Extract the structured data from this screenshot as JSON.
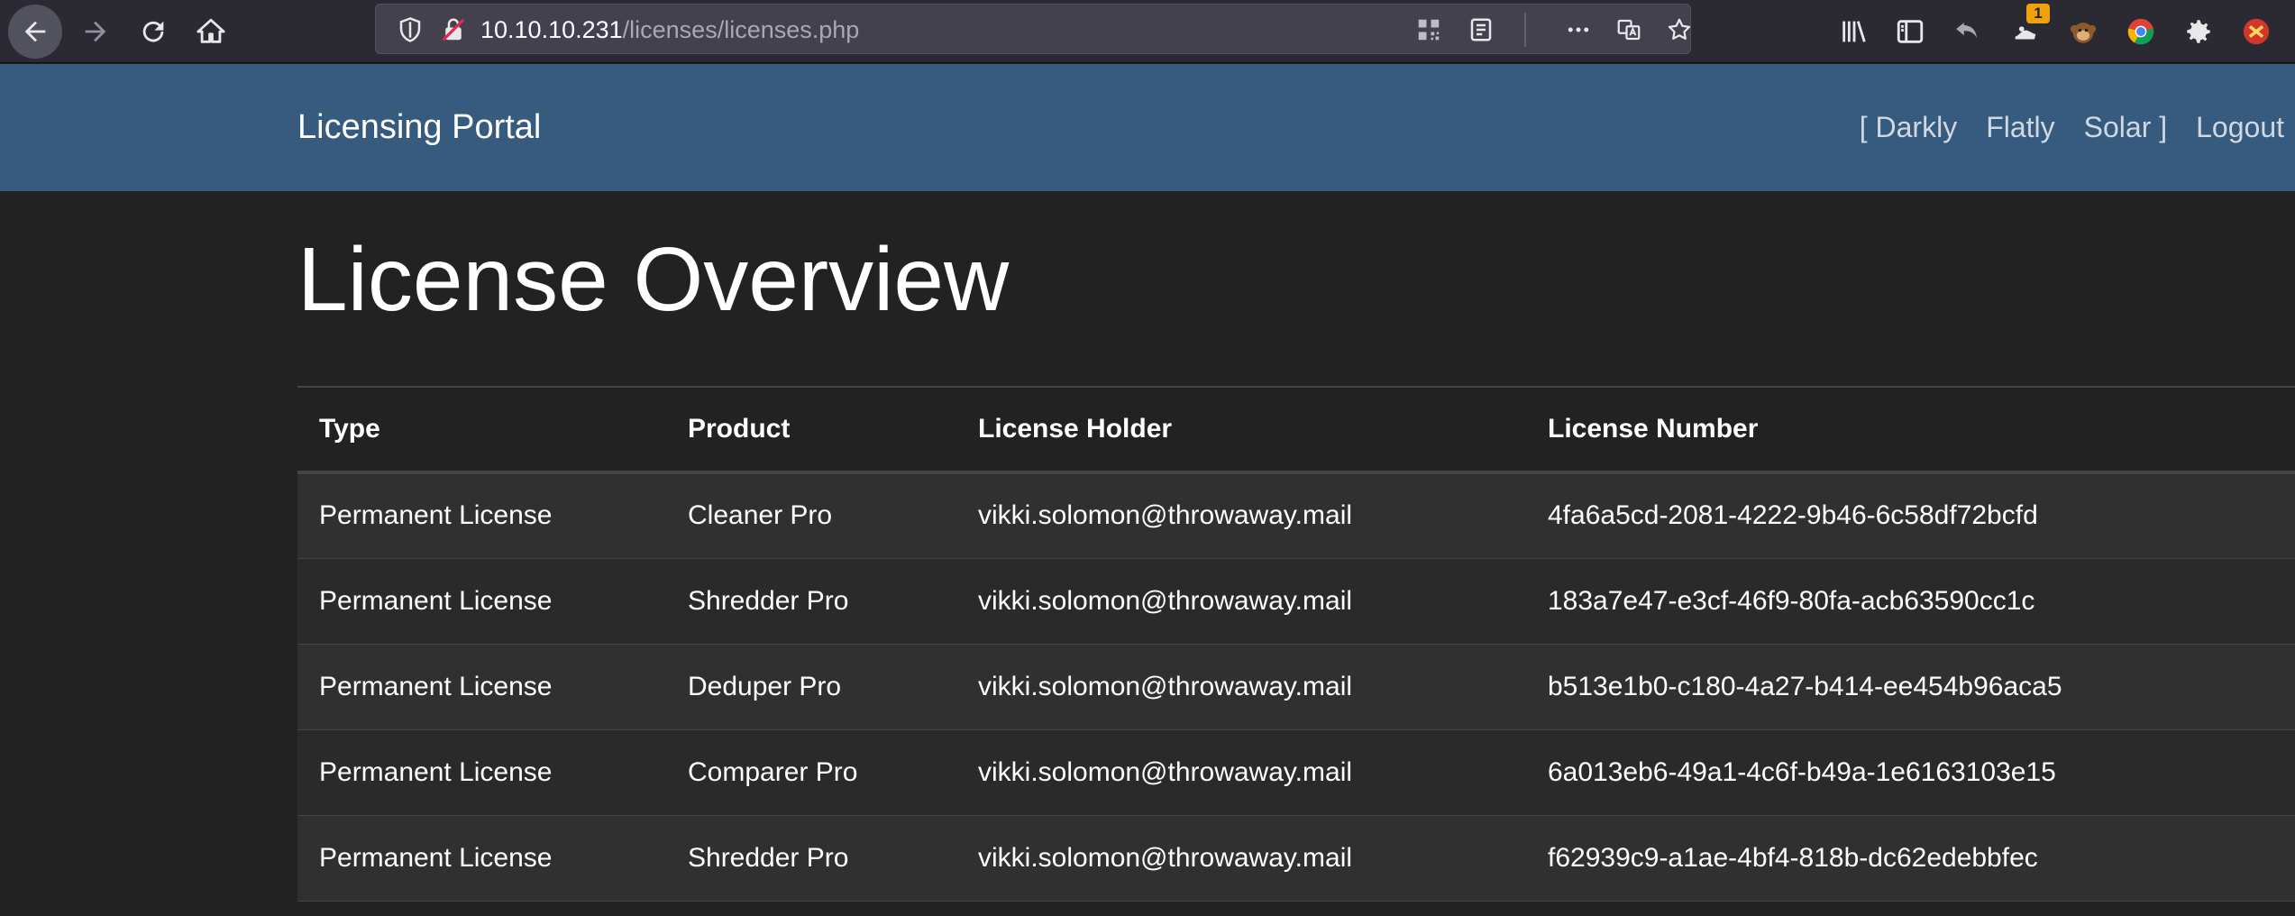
{
  "browser": {
    "url_host": "10.10.10.231",
    "url_path": "/licenses/licenses.php",
    "addon_badge": "1"
  },
  "navbar": {
    "brand": "Licensing Portal",
    "links": [
      "[ Darkly",
      "Flatly",
      "Solar ]",
      "Logout"
    ]
  },
  "main": {
    "title": "License Overview",
    "table": {
      "headers": [
        "Type",
        "Product",
        "License Holder",
        "License Number"
      ],
      "rows": [
        [
          "Permanent License",
          "Cleaner Pro",
          "vikki.solomon@throwaway.mail",
          "4fa6a5cd-2081-4222-9b46-6c58df72bcfd"
        ],
        [
          "Permanent License",
          "Shredder Pro",
          "vikki.solomon@throwaway.mail",
          "183a7e47-e3cf-46f9-80fa-acb63590cc1c"
        ],
        [
          "Permanent License",
          "Deduper Pro",
          "vikki.solomon@throwaway.mail",
          "b513e1b0-c180-4a27-b414-ee454b96aca5"
        ],
        [
          "Permanent License",
          "Comparer Pro",
          "vikki.solomon@throwaway.mail",
          "6a013eb6-49a1-4c6f-b49a-1e6163103e15"
        ],
        [
          "Permanent License",
          "Shredder Pro",
          "vikki.solomon@throwaway.mail",
          "f62939c9-a1ae-4bf4-818b-dc62edebbfec"
        ]
      ]
    }
  }
}
